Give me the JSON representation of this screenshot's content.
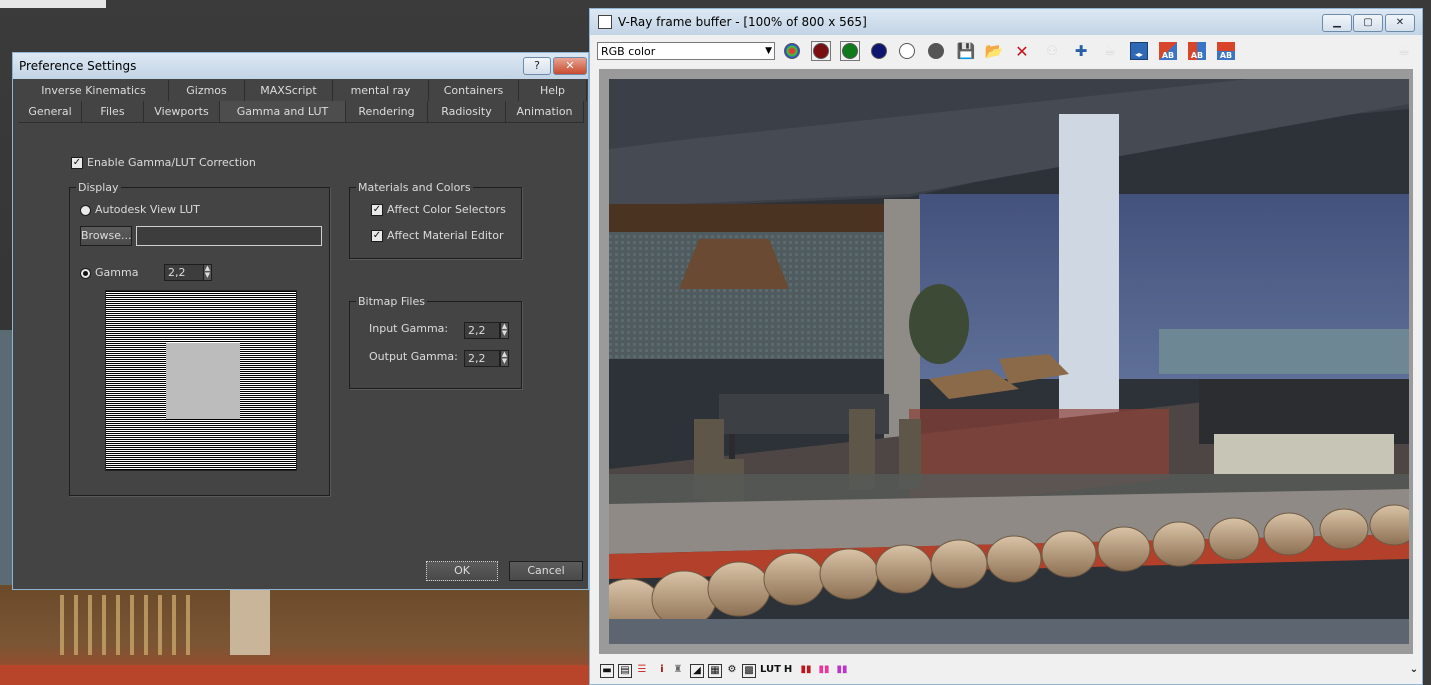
{
  "preferences": {
    "title": "Preference Settings",
    "help_label": "?",
    "close_label": "✕",
    "tabs_row1": [
      "Inverse Kinematics",
      "Gizmos",
      "MAXScript",
      "mental ray",
      "Containers",
      "Help"
    ],
    "tabs_row2": [
      "General",
      "Files",
      "Viewports",
      "Gamma and LUT",
      "Rendering",
      "Radiosity",
      "Animation"
    ],
    "active_tab": "Gamma and LUT",
    "enable_gamma_label": "Enable Gamma/LUT Correction",
    "display": {
      "title": "Display",
      "autodesk_lut_label": "Autodesk View LUT",
      "browse_label": "Browse...",
      "lut_path": "",
      "gamma_label": "Gamma",
      "gamma_value": "2,2"
    },
    "materials": {
      "title": "Materials and Colors",
      "affect_color_label": "Affect Color Selectors",
      "affect_material_label": "Affect Material Editor"
    },
    "bitmap": {
      "title": "Bitmap Files",
      "input_gamma_label": "Input Gamma:",
      "input_gamma_value": "2,2",
      "output_gamma_label": "Output Gamma:",
      "output_gamma_value": "2,2"
    },
    "ok_label": "OK",
    "cancel_label": "Cancel"
  },
  "vfb": {
    "title": "V-Ray frame buffer - [100% of 800 x 565]",
    "channel": "RGB color",
    "ab_a": "A",
    "ab_b": "B",
    "lut_label": "LUT",
    "h_label": "H",
    "info_label": "i",
    "colors": {
      "red_channel": "#7a0f12",
      "green_channel": "#0f7a1c",
      "blue_channel": "#0f1670",
      "ab_compare": "#d9452a",
      "ab_compare_blue": "#3b74c6"
    }
  }
}
